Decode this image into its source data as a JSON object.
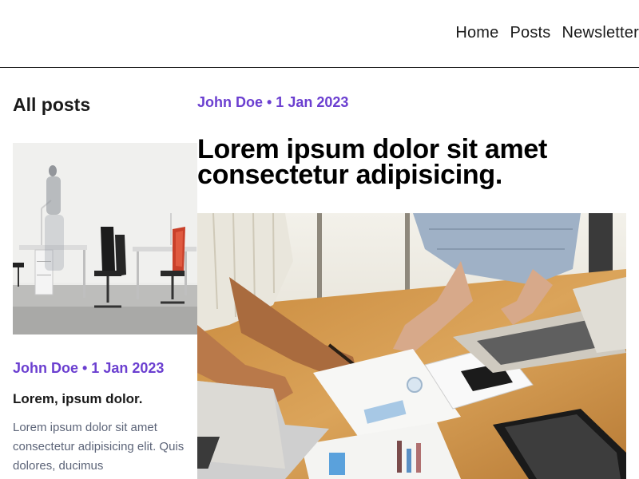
{
  "nav": {
    "items": [
      "Home",
      "Posts",
      "Newsletter"
    ]
  },
  "sidebar": {
    "title": "All posts",
    "post": {
      "meta": "John Doe • 1 Jan 2023",
      "title": "Lorem, ipsum dolor.",
      "excerpt": "Lorem ipsum dolor sit amet consectetur adipisicing elit. Quis dolores, ducimus"
    }
  },
  "main": {
    "meta": "John Doe • 1 Jan 2023",
    "title": "Lorem ipsum dolor sit amet consectetur adipisicing."
  },
  "colors": {
    "accent": "#6b3fd0",
    "text": "#1a1a1a",
    "muted": "#5c6478"
  }
}
